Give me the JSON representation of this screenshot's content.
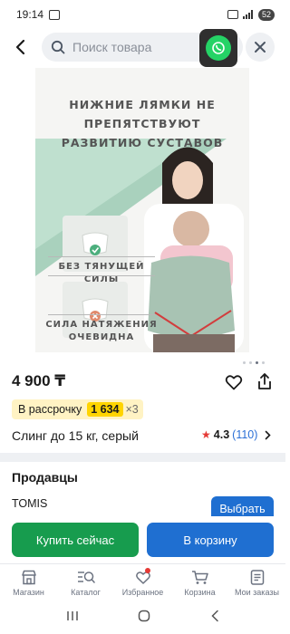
{
  "status_bar": {
    "time": "19:14",
    "battery": "52"
  },
  "header": {
    "search_placeholder": "Поиск товара",
    "icons": [
      "back-icon",
      "search-icon",
      "whatsapp-icon",
      "close-icon"
    ]
  },
  "product_image": {
    "headline_line1": "НИЖНИЕ ЛЯМКИ НЕ ПРЕПЯТСТВУЮТ",
    "headline_line2": "РАЗВИТИЮ СУСТАВОВ",
    "feature1": "БЕЗ ТЯНУЩЕЙ СИЛЫ",
    "feature2_line1": "СИЛА НАТЯЖЕНИЯ",
    "feature2_line2": "ОЧЕВИДНА",
    "pager_total": 4,
    "pager_active": 3
  },
  "product": {
    "price": "4 900 ₸",
    "installment_label": "В рассрочку",
    "installment_amount": "1 634",
    "installment_multiplier": "×3",
    "title": "Слинг до 15 кг, серый",
    "rating": "4.3",
    "reviews": "(110)"
  },
  "sellers": {
    "title": "Продавцы",
    "seller_name": "TOMIS",
    "select_label": "Выбрать"
  },
  "actions": {
    "buy_now": "Купить сейчас",
    "add_to_cart": "В корзину"
  },
  "tabbar": {
    "tabs": [
      {
        "label": "Магазин",
        "icon": "shop-icon"
      },
      {
        "label": "Каталог",
        "icon": "catalog-search-icon"
      },
      {
        "label": "Избранное",
        "icon": "heart-icon"
      },
      {
        "label": "Корзина",
        "icon": "cart-icon"
      },
      {
        "label": "Мои заказы",
        "icon": "orders-icon"
      }
    ]
  },
  "colors": {
    "buy_button": "#179c4e",
    "cart_button": "#1f6fd1",
    "installment_bg": "#fff3c4",
    "installment_amount_bg": "#ffd400",
    "rating_count": "#2a6fd6",
    "badge": "#e53935"
  }
}
